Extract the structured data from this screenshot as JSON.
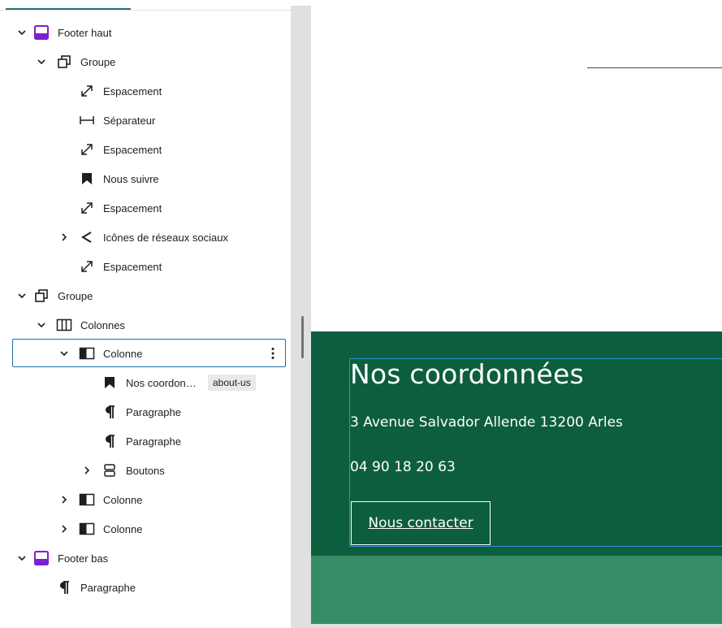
{
  "list_view": {
    "items": [
      {
        "label": "Footer haut",
        "icon": "template-part-icon",
        "chevron": "down"
      },
      {
        "label": "Groupe",
        "icon": "group-icon",
        "chevron": "down"
      },
      {
        "label": "Espacement",
        "icon": "spacer-icon"
      },
      {
        "label": "Séparateur",
        "icon": "separator-icon"
      },
      {
        "label": "Espacement",
        "icon": "spacer-icon"
      },
      {
        "label": "Nous suivre",
        "icon": "bookmark-icon"
      },
      {
        "label": "Espacement",
        "icon": "spacer-icon"
      },
      {
        "label": "Icônes de réseaux sociaux",
        "icon": "share-icon",
        "chevron": "right"
      },
      {
        "label": "Espacement",
        "icon": "spacer-icon"
      },
      {
        "label": "Groupe",
        "icon": "group-icon",
        "chevron": "down"
      },
      {
        "label": "Colonnes",
        "icon": "columns-icon",
        "chevron": "down"
      },
      {
        "label": "Colonne",
        "icon": "column-icon",
        "chevron": "down",
        "selected": true
      },
      {
        "label": "Nos coordon…",
        "icon": "bookmark-icon",
        "badge": "about-us"
      },
      {
        "label": "Paragraphe",
        "icon": "paragraph-icon"
      },
      {
        "label": "Paragraphe",
        "icon": "paragraph-icon"
      },
      {
        "label": "Boutons",
        "icon": "buttons-icon",
        "chevron": "right"
      },
      {
        "label": "Colonne",
        "icon": "column-icon",
        "chevron": "right"
      },
      {
        "label": "Colonne",
        "icon": "column-icon",
        "chevron": "right"
      },
      {
        "label": "Footer bas",
        "icon": "template-part-icon",
        "chevron": "down"
      },
      {
        "label": "Paragraphe",
        "icon": "paragraph-icon"
      }
    ],
    "options_icon": "vertical-ellipsis-icon"
  },
  "canvas": {
    "heading": "Nos coordonnées",
    "address": "3 Avenue Salvador Allende 13200 Arles",
    "phone": "04 90 18 20 63",
    "button_label": "Nous contacter"
  },
  "colors": {
    "footer_haut": "#0d5e3e",
    "footer_bas": "#358c65",
    "selection": "#1e6fa8",
    "template_part_accent": "#7b1fd4"
  }
}
